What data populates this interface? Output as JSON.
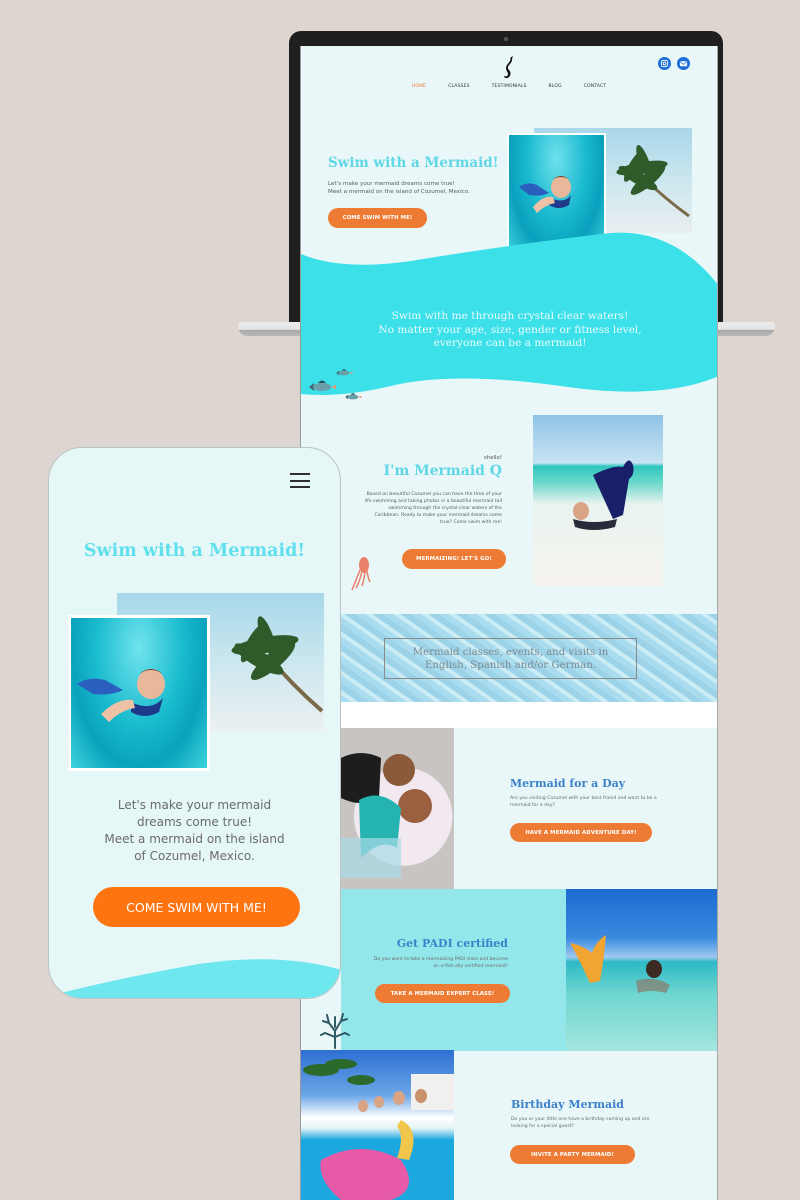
{
  "colors": {
    "accent_orange": "#ee7b33",
    "mobile_orange": "#fe7410",
    "aqua": "#3be0e8",
    "title_cyan": "#5fd7e6",
    "heading_blue": "#3c82c9",
    "page_bg": "#eaf7f8",
    "backdrop": "#ddd5cf"
  },
  "desktop": {
    "logo": "mermaid-silhouette-logo",
    "social": [
      "instagram-icon",
      "email-icon"
    ],
    "nav": [
      {
        "label": "HOME",
        "active": true
      },
      {
        "label": "CLASSES",
        "active": false
      },
      {
        "label": "TESTIMONIALS",
        "active": false
      },
      {
        "label": "BLOG",
        "active": false
      },
      {
        "label": "CONTACT",
        "active": false
      }
    ],
    "hero": {
      "title": "Swim with a Mermaid!",
      "line1": "Let's make your mermaid dreams come true!",
      "line2": "Meet a mermaid on the island of Cozumel, Mexico.",
      "button": "COME SWIM WITH ME!"
    },
    "band": {
      "line1": "Swim with me through crystal clear waters!",
      "line2": "No matter your age, size, gender or fitness level,",
      "line3": "everyone can be a mermaid!"
    },
    "about": {
      "greeting": "shello!",
      "title": "I'm Mermaid Q",
      "text": "Based on beautiful Cozumel you can have the time of your life swimming and taking photos in a beautiful mermaid tail swimming through the crystal-clear waters of the Caribbean. Ready to make your mermaid dreams come true? Come swim with me!",
      "button": "MERMAIZING! LET'S GO!"
    },
    "banner": {
      "line1": "Mermaid classes, events, and visits in",
      "line2": "English, Spanish and/or German."
    },
    "day": {
      "title": "Mermaid for a Day",
      "text": "Are you visiting Cozumel with your best friend and want to be a mermaid for a day?",
      "button": "HAVE A MERMAID ADVENTURE DAY!"
    },
    "padi": {
      "title": "Get PADI certified",
      "text": "Do you want to take a mermaizing PADI class and become an o-fish-ally certified mermaid?",
      "button": "TAKE A MERMAID EXPERT CLASS!"
    },
    "birthday": {
      "title": "Birthday Mermaid",
      "text": "Do you or your little one have a birthday coming up and are looking for a special guest?",
      "button": "INVITE A PARTY MERMAID!"
    }
  },
  "mobile": {
    "menu_icon": "hamburger-menu-icon",
    "title": "Swim with a Mermaid!",
    "line1": "Let's make your mermaid",
    "line2": "dreams come true!",
    "line3": "Meet a mermaid on the island",
    "line4": "of Cozumel, Mexico.",
    "button": "COME SWIM WITH ME!"
  }
}
